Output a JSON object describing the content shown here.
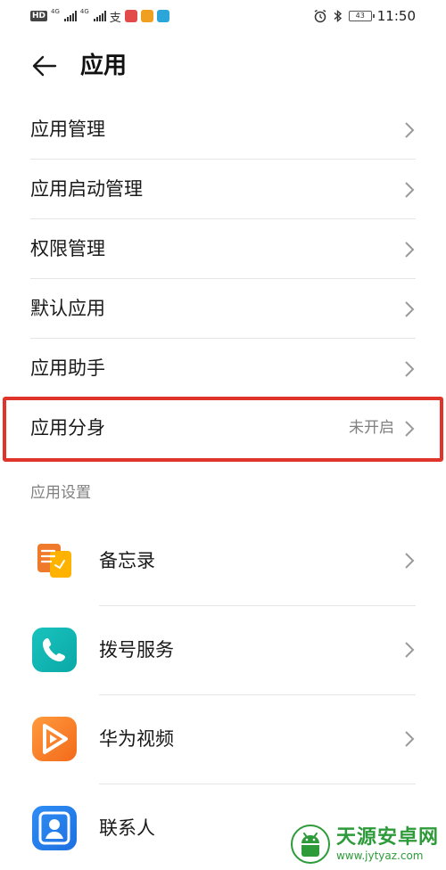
{
  "status_bar": {
    "hd": "HD",
    "net1": "4G",
    "net2": "4G",
    "glyph": "支",
    "battery": "43",
    "time": "11:50"
  },
  "header": {
    "title": "应用"
  },
  "menu": {
    "items": [
      {
        "label": "应用管理"
      },
      {
        "label": "应用启动管理"
      },
      {
        "label": "权限管理"
      },
      {
        "label": "默认应用"
      },
      {
        "label": "应用助手"
      },
      {
        "label": "应用分身",
        "value": "未开启"
      }
    ]
  },
  "section": {
    "title": "应用设置"
  },
  "apps": [
    {
      "label": "备忘录",
      "icon": "memo-icon"
    },
    {
      "label": "拨号服务",
      "icon": "phone-icon"
    },
    {
      "label": "华为视频",
      "icon": "video-play-icon"
    },
    {
      "label": "联系人",
      "icon": "contacts-icon"
    }
  ],
  "watermark": {
    "title": "天源安卓网",
    "url": "www.jytyaz.com"
  },
  "colors": {
    "highlight": "#e0342b",
    "secondary_text": "#808080",
    "watermark": "#2e9b3a"
  }
}
